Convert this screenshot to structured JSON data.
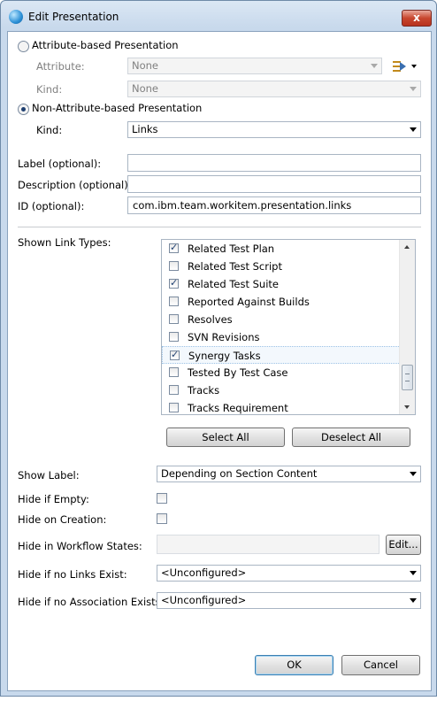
{
  "window": {
    "title": "Edit Presentation",
    "close_glyph": "x"
  },
  "attribute_based": {
    "label": "Attribute-based Presentation",
    "attribute_label": "Attribute:",
    "attribute_value": "None",
    "kind_label": "Kind:",
    "kind_value": "None"
  },
  "non_attribute_based": {
    "label": "Non-Attribute-based Presentation",
    "kind_label": "Kind:",
    "kind_value": "Links"
  },
  "fields": {
    "label_label": "Label (optional):",
    "label_value": "",
    "description_label": "Description (optional):",
    "description_value": "",
    "id_label": "ID (optional):",
    "id_value": "com.ibm.team.workitem.presentation.links"
  },
  "link_types": {
    "label": "Shown Link Types:",
    "items": [
      {
        "label": "Related Test Plan",
        "checked": true
      },
      {
        "label": "Related Test Script",
        "checked": false
      },
      {
        "label": "Related Test Suite",
        "checked": true
      },
      {
        "label": "Reported Against Builds",
        "checked": false
      },
      {
        "label": "Resolves",
        "checked": false
      },
      {
        "label": "SVN Revisions",
        "checked": false
      },
      {
        "label": "Synergy Tasks",
        "checked": true
      },
      {
        "label": "Tested By Test Case",
        "checked": false
      },
      {
        "label": "Tracks",
        "checked": false
      },
      {
        "label": "Tracks Requirement",
        "checked": false
      }
    ],
    "select_all": "Select All",
    "deselect_all": "Deselect All"
  },
  "options": {
    "show_label_label": "Show Label:",
    "show_label_value": "Depending on Section Content",
    "hide_if_empty_label": "Hide if Empty:",
    "hide_if_empty_checked": false,
    "hide_on_creation_label": "Hide on Creation:",
    "hide_on_creation_checked": false,
    "hide_in_workflow_label": "Hide in Workflow States:",
    "hide_in_workflow_value": "",
    "edit_button": "Edit...",
    "hide_no_links_label": "Hide if no Links Exist:",
    "hide_no_links_value": "<Unconfigured>",
    "hide_no_assoc_label": "Hide if no Association Exists:",
    "hide_no_assoc_value": "<Unconfigured>"
  },
  "buttons": {
    "ok": "OK",
    "cancel": "Cancel"
  }
}
